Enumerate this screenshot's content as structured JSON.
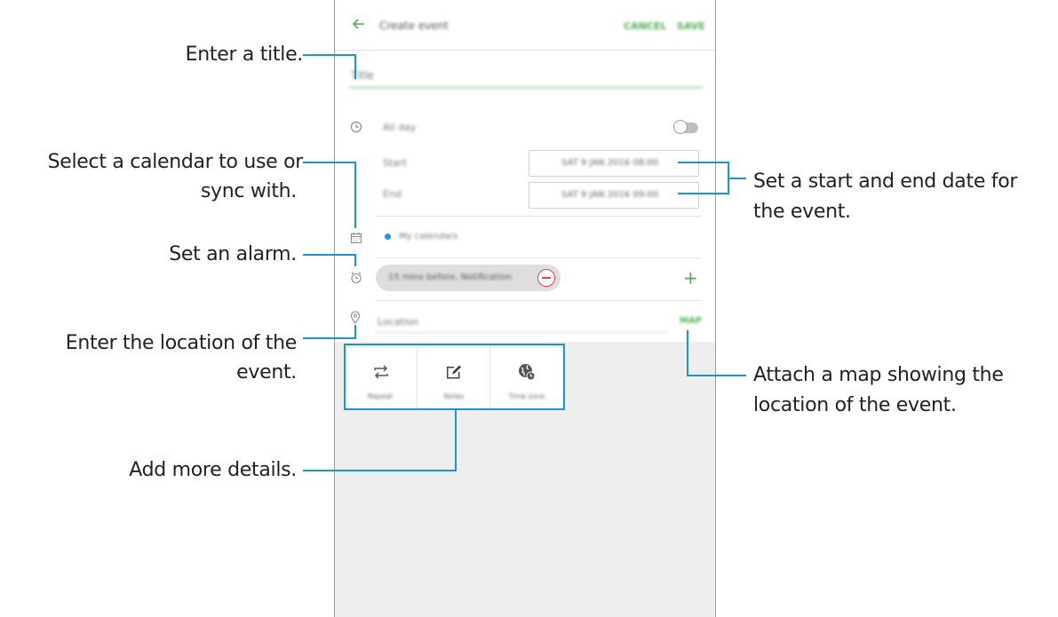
{
  "callouts": {
    "title": "Enter a title.",
    "calendar_line1": "Select a calendar to use or",
    "calendar_line2": "sync with.",
    "alarm": "Set an alarm.",
    "location_line1": "Enter the location of the",
    "location_line2": "event.",
    "more_details": "Add more details.",
    "dates_line1": "Set a start and end date for",
    "dates_line2": "the event.",
    "map_line1": "Attach a map showing the",
    "map_line2": "location of the event."
  },
  "appbar": {
    "title": "Create event",
    "cancel_label": "CANCEL",
    "save_label": "SAVE"
  },
  "form": {
    "title_placeholder": "Title",
    "all_day_label": "All day",
    "start_label": "Start",
    "end_label": "End",
    "start_value": "SAT 9 JAN 2016   08:00",
    "end_value": "SAT 9 JAN 2016   09:00",
    "calendar_name": "My calendars",
    "alarm_chip": "15 mins before, Notification",
    "location_placeholder": "Location",
    "map_label": "MAP"
  },
  "details": {
    "repeat_label": "Repeat",
    "notes_label": "Notes",
    "timezone_label": "Time zone"
  },
  "colors": {
    "accent_green": "#4caf50",
    "callout_blue": "#1b95cc",
    "calendar_dot": "#2196f3",
    "remove_red": "#e04848"
  },
  "icons": [
    "back-arrow-icon",
    "clock-icon",
    "calendar-icon",
    "alarm-icon",
    "location-pin-icon",
    "repeat-icon",
    "notes-icon",
    "timezone-icon"
  ]
}
